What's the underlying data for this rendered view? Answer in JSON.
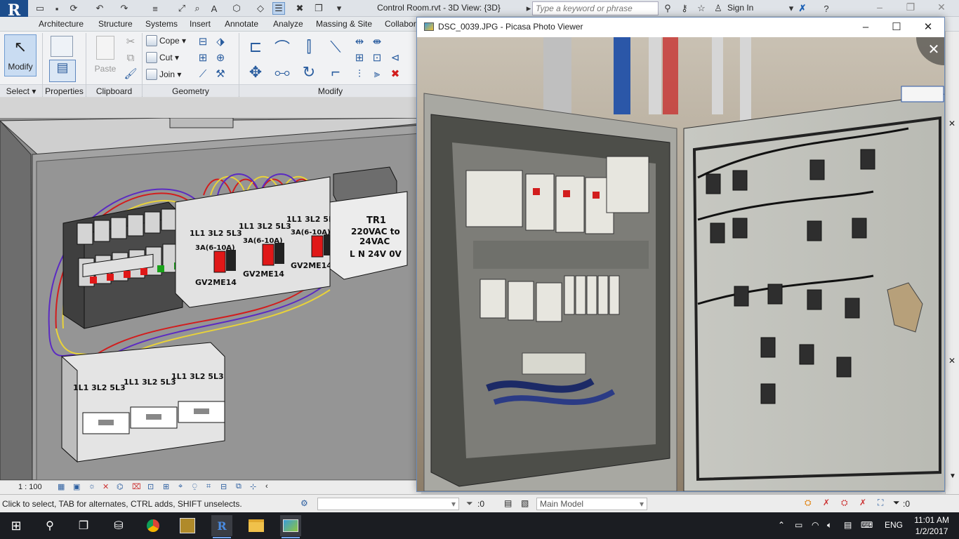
{
  "revit": {
    "title": "Control Room.rvt - 3D View: {3D}",
    "search_placeholder": "Type a keyword or phrase",
    "sign_in": "Sign In",
    "tabs": [
      "Architecture",
      "Structure",
      "Systems",
      "Insert",
      "Annotate",
      "Analyze",
      "Massing & Site",
      "Collabor"
    ],
    "ribbon": {
      "modify": "Modify",
      "paste": "Paste",
      "cope": "Cope",
      "cut": "Cut",
      "join": "Join",
      "panels": [
        "Select",
        "Properties",
        "Clipboard",
        "Geometry",
        "Modify"
      ]
    },
    "view": {
      "scale": "1 : 100",
      "labels": {
        "tr1": "TR1",
        "tr1_voltage": "220VAC to",
        "tr1_voltage2": "24VAC",
        "tr1_terminals": "L  N   24V 0V",
        "breaker_range": "3A(6-10A)",
        "breaker_model": "GV2ME14",
        "terminal_row": "1L1 3L2 5L3"
      }
    },
    "status": {
      "hint": "Click to select, TAB for alternates, CTRL adds, SHIFT unselects.",
      "filter_count": ":0",
      "main_model": "Main Model",
      "selection_count": ":0"
    }
  },
  "picasa": {
    "title": "DSC_0039.JPG - Picasa Photo Viewer",
    "close_overlay": "✕"
  },
  "taskbar": {
    "language": "ENG",
    "time": "11:01 AM",
    "date": "1/2/2017"
  },
  "colors": {
    "revit_blue": "#1c4d8c",
    "taskbar": "#1b1d22",
    "wire_red": "#d21d1d",
    "wire_yellow": "#e8d23a",
    "wire_purple": "#5b2bc2"
  }
}
